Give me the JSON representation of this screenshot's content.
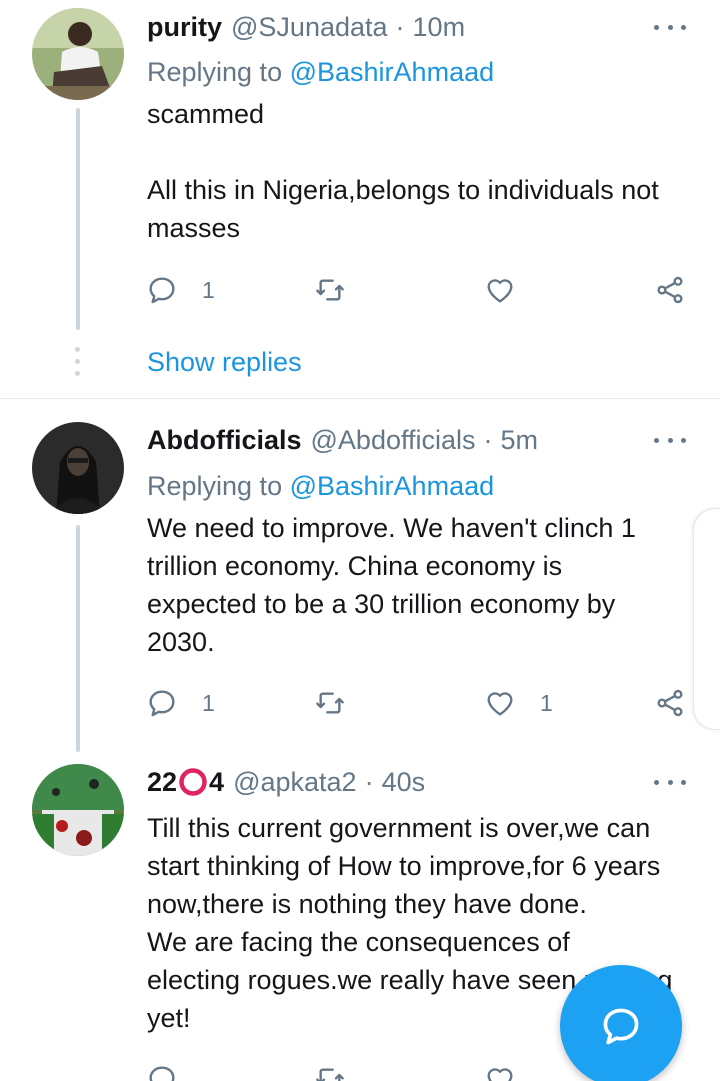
{
  "colors": {
    "text_primary": "#14171a",
    "text_secondary": "#657786",
    "link": "#1b95e0",
    "fab": "#1da1f2",
    "thread_line": "#ccd6dd",
    "divider": "#e6ecf0"
  },
  "tweets": [
    {
      "name": "purity",
      "handle": "@SJunadata",
      "separator": "·",
      "time": "10m",
      "replying_prefix": "Replying to",
      "replying_mention": "@BashirAhmaad",
      "body": [
        "scammed",
        "",
        "All this in Nigeria,belongs to individuals not",
        "masses"
      ],
      "reply_count": "1",
      "retweet_count": "",
      "like_count": ""
    },
    {
      "name": "Abdofficials",
      "handle": "@Abdofficials",
      "separator": "·",
      "time": "5m",
      "replying_prefix": "Replying to",
      "replying_mention": "@BashirAhmaad",
      "body": [
        "We need to improve. We haven't clinch 1",
        "trillion economy. China economy is",
        "expected to be a 30 trillion economy by",
        "2030."
      ],
      "reply_count": "1",
      "retweet_count": "",
      "like_count": "1"
    },
    {
      "name": "22",
      "name_suffix": "4",
      "handle": "@apkata2",
      "separator": "·",
      "time": "40s",
      "body": [
        "Till this current government is over,we can",
        "start thinking of How to improve,for 6 years",
        "now,there is nothing they have done.",
        "We are facing the consequences of",
        "electing rogues.we really have seen nothing",
        "yet!"
      ]
    }
  ],
  "show_replies_label": "Show replies",
  "icons": {
    "reply": "reply-icon",
    "retweet": "retweet-icon",
    "like": "heart-icon",
    "share": "share-icon",
    "more": "more-dots-icon",
    "compose": "compose-reply-icon"
  }
}
